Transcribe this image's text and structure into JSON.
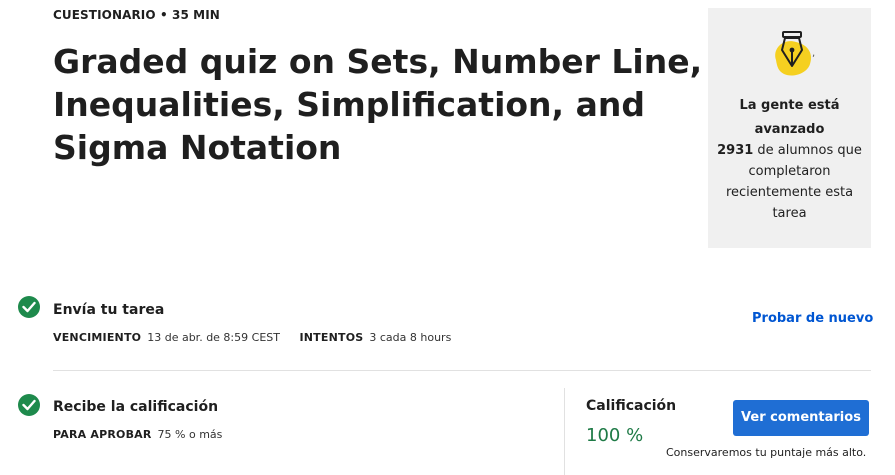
{
  "header": {
    "kicker": "CUESTIONARIO • 35 MIN",
    "title": "Graded quiz on Sets, Number Line, Inequalities, Simplification, and Sigma Notation"
  },
  "side_card": {
    "icon": "pen-nib-icon",
    "tick": ",",
    "heading": "La gente está avanzado",
    "count": "2931",
    "body": " de alumnos que completaron recientemente esta tarea"
  },
  "submit_section": {
    "title": "Envía tu tarea",
    "due_label": "VENCIMIENTO",
    "due_value": "13 de abr. de 8:59 CEST",
    "attempts_label": "INTENTOS",
    "attempts_value": "3 cada 8 hours",
    "retry_label": "Probar de nuevo"
  },
  "grade_section": {
    "title": "Recibe la calificación",
    "pass_label": "PARA APROBAR",
    "pass_value": "75 % o más",
    "grade_label": "Calificación",
    "grade_value": "100 %",
    "feedback_button": "Ver comentarios",
    "keep_note": "Conservaremos tu puntaje más alto."
  },
  "colors": {
    "accent": "#0056d2",
    "button": "#1f6ed4",
    "success": "#1e8a4c",
    "card_bg": "#f0f0f0",
    "badge_yellow": "#f5d020"
  }
}
